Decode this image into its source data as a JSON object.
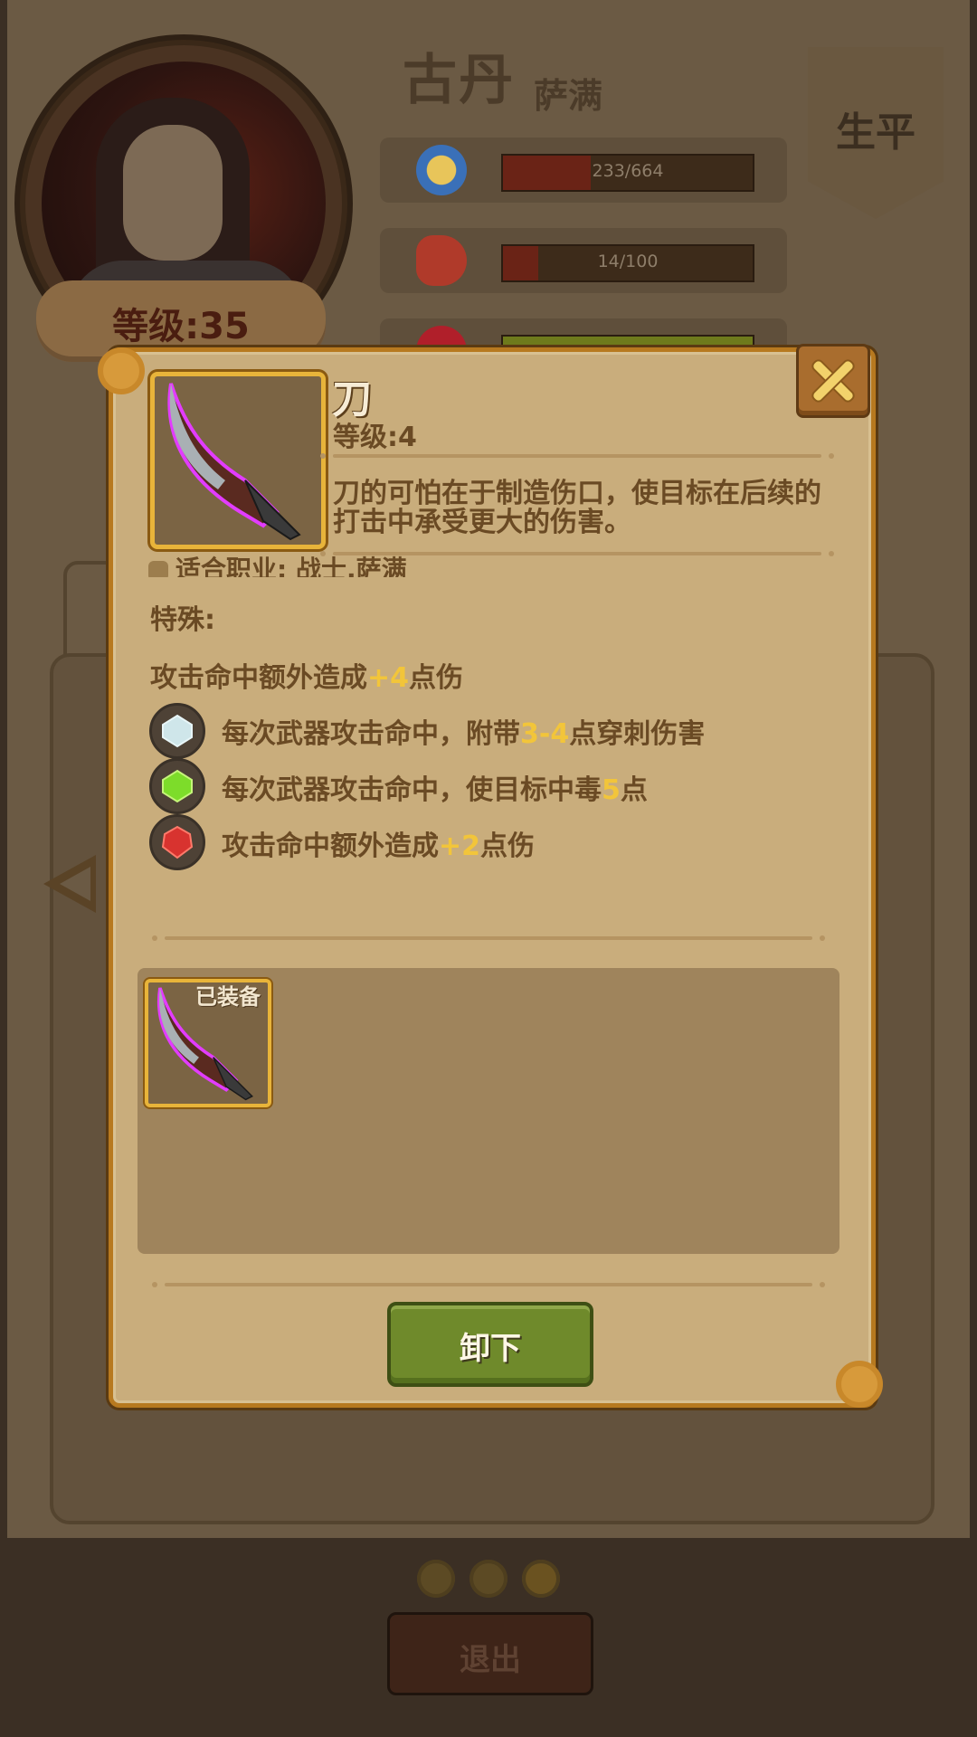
{
  "background": {
    "hero_name": "古丹",
    "hero_class": "萨满",
    "level_label": "等级:35",
    "stats": [
      {
        "icon": "medal-icon",
        "value": "233/664",
        "fill": 0.35
      },
      {
        "icon": "stomach-icon",
        "value": "14/100",
        "fill": 0.14
      },
      {
        "icon": "heart-icon",
        "value": "",
        "fill": 1.0
      }
    ],
    "banner_label": "生平",
    "exit_label": "退出",
    "page_dots": 3
  },
  "dialog": {
    "item": {
      "name": "刀",
      "level": "等级:4",
      "description": "刀的可怕在于制造伤口，使目标在后续的打击中承受更大的伤害。",
      "classes": "适合职业: 战士,萨满",
      "special_label": "特殊:"
    },
    "base_effect": {
      "prefix": "攻击命中额外造成",
      "value": "+4",
      "suffix": "点伤"
    },
    "gem_effects": [
      {
        "gem": "diamond-gem-icon",
        "color": "#cfe6ea",
        "prefix": "每次武器攻击命中，附带",
        "value": "3-4",
        "suffix": "点穿刺伤害"
      },
      {
        "gem": "emerald-gem-icon",
        "color": "#7ddc2a",
        "prefix": "每次武器攻击命中，使目标中毒",
        "value": "5",
        "suffix": "点"
      },
      {
        "gem": "ruby-gem-icon",
        "color": "#d8332f",
        "prefix": "攻击命中额外造成",
        "value": "+2",
        "suffix": "点伤"
      }
    ],
    "equipped_label": "已装备",
    "unequip_label": "卸下"
  },
  "colors": {
    "highlight": "#f2c53a",
    "item_glow": "#e23cff",
    "button_green": "#6f8a2b"
  }
}
